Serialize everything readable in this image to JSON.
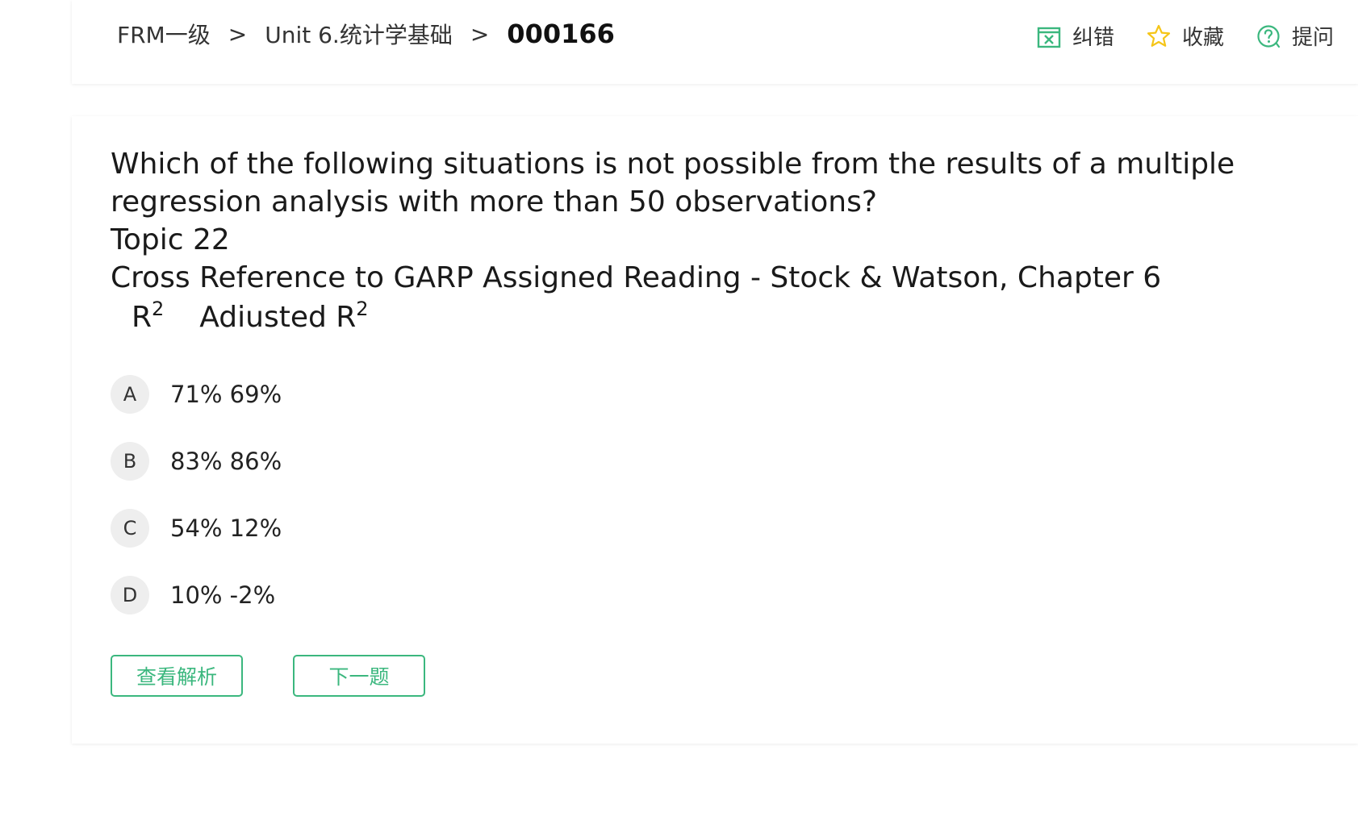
{
  "breadcrumb": {
    "level1": "FRM一级",
    "separator": ">",
    "level2": "Unit 6.统计学基础",
    "current": "000166"
  },
  "actions": {
    "report_error": {
      "label": "纠错",
      "icon": "report-error-icon"
    },
    "favorite": {
      "label": "收藏",
      "icon": "star-icon"
    },
    "ask": {
      "label": "提问",
      "icon": "question-circle-icon"
    }
  },
  "question": {
    "line1": "Which of the following situations is not possible from the results of a multiple",
    "line2": "regression analysis with more than 50 observations?",
    "topic": "Topic 22",
    "reference": "Cross Reference to GARP Assigned Reading - Stock & Watson, Chapter 6",
    "col1": "R",
    "col1_sup": "2",
    "col2": "Adiusted R",
    "col2_sup": "2"
  },
  "options": [
    {
      "letter": "A",
      "text": "71% 69%"
    },
    {
      "letter": "B",
      "text": "83% 86%"
    },
    {
      "letter": "C",
      "text": "54% 12%"
    },
    {
      "letter": "D",
      "text": "10% -2%"
    }
  ],
  "buttons": {
    "view_analysis": "查看解析",
    "next_question": "下一题"
  },
  "colors": {
    "accent_green": "#3bb77e",
    "star_yellow": "#f5c518",
    "option_circle_bg": "#eeeeee"
  }
}
